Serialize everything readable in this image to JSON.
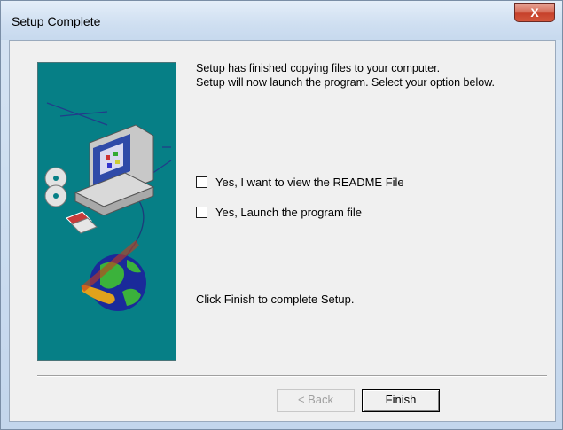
{
  "window": {
    "title": "Setup Complete",
    "close_glyph": "X"
  },
  "message": {
    "line1": "Setup has finished copying files to your computer.",
    "line2": "Setup will now launch the program. Select your option below."
  },
  "options": [
    {
      "label": "Yes, I want to view the README File",
      "checked": false
    },
    {
      "label": "Yes, Launch the program file",
      "checked": false
    }
  ],
  "finish_message": "Click Finish to complete Setup.",
  "buttons": {
    "back": "< Back",
    "finish": "Finish"
  },
  "colors": {
    "panel": "#067f86",
    "accent_close": "#c6412b"
  },
  "icons": [
    "computer-illustration",
    "cd-icon",
    "globe-icon",
    "floppy-icon"
  ]
}
